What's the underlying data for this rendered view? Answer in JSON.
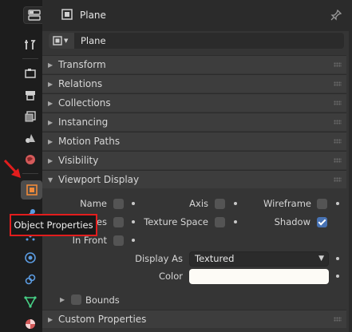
{
  "header": {
    "object_name": "Plane",
    "pin_icon": "pin-icon"
  },
  "name_field": {
    "value": "Plane"
  },
  "sections": [
    {
      "label": "Transform",
      "expanded": false
    },
    {
      "label": "Relations",
      "expanded": false
    },
    {
      "label": "Collections",
      "expanded": false
    },
    {
      "label": "Instancing",
      "expanded": false
    },
    {
      "label": "Motion Paths",
      "expanded": false
    },
    {
      "label": "Visibility",
      "expanded": false
    },
    {
      "label": "Viewport Display",
      "expanded": true
    }
  ],
  "viewport_display": {
    "name_label": "Name",
    "axis_label": "Axis",
    "wireframe_label": "Wireframe",
    "edges_label_partial": "es",
    "texture_space_label": "Texture Space",
    "shadow_label": "Shadow",
    "in_front_label": "In Front",
    "display_as_label": "Display As",
    "display_as_value": "Textured",
    "color_label": "Color",
    "color_value": "#fdfbf6",
    "bounds_label": "Bounds"
  },
  "custom_properties": {
    "label": "Custom Properties"
  },
  "tooltip": {
    "text": "Object Properties"
  },
  "colors": {
    "accent": "#4772b3",
    "highlight": "#e21d1d",
    "object_tab": "#f08a3a"
  }
}
